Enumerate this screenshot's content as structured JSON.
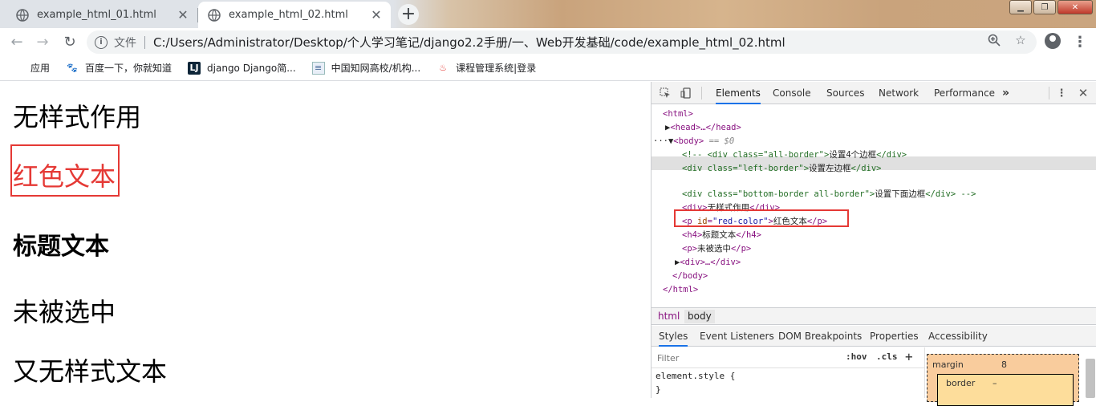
{
  "tabs": [
    {
      "title": "example_html_01.html"
    },
    {
      "title": "example_html_02.html"
    }
  ],
  "omnibox": {
    "file_label": "文件",
    "url": "C:/Users/Administrator/Desktop/个人学习笔记/django2.2手册/一、Web开发基础/code/example_html_02.html"
  },
  "bookmarks": [
    {
      "label": "应用",
      "icon": "apps-grid-icon"
    },
    {
      "label": "百度一下，你就知道",
      "icon": "baidu-paw-icon"
    },
    {
      "label": "django Django简...",
      "icon": "lj-logo-icon"
    },
    {
      "label": "中国知网高校/机构...",
      "icon": "document-icon"
    },
    {
      "label": "课程管理系统|登录",
      "icon": "flame-icon"
    }
  ],
  "page": {
    "line1": "无样式作用",
    "line2": "红色文本",
    "line3": "标题文本",
    "line4": "未被选中",
    "line5": "又无样式文本",
    "accent_red": "#e53935"
  },
  "devtools": {
    "tabs": [
      "Elements",
      "Console",
      "Sources",
      "Network",
      "Performance"
    ],
    "more": "»",
    "dom": {
      "html_open": "<html>",
      "head": "<head>…</head>",
      "body_tag": "<body>",
      "body_suffix": "== $0",
      "comment1_prefix": "<!-- <div class=\"all-border\">",
      "comment1_text": "设置4个边框",
      "comment1_close": "</div>",
      "comment2_open": "<div class=\"left-border\">",
      "comment2_text": "设置左边框",
      "comment2_close": "</div>",
      "comment3_open": "<div class=\"bottom-border all-border\">",
      "comment3_text": "设置下面边框",
      "comment3_close": "</div> -->",
      "div1_open": "<div>",
      "div1_text": "无样式作用",
      "div1_close": "</div>",
      "p_open_tag": "<p ",
      "p_attr": "id",
      "p_val": "\"red-color\"",
      "p_text": "红色文本",
      "p_close": "</p>",
      "h4_open": "<h4>",
      "h4_text": "标题文本",
      "h4_close": "</h4>",
      "p2_open": "<p>",
      "p2_text": "未被选中",
      "p2_close": "</p>",
      "div2": "<div>…</div>",
      "body_close": "</body>",
      "html_close": "</html>"
    },
    "breadcrumbs": [
      "html",
      "body"
    ],
    "subtabs": [
      "Styles",
      "Event Listeners",
      "DOM Breakpoints",
      "Properties",
      "Accessibility"
    ],
    "filter_placeholder": "Filter",
    "hov": ":hov",
    "cls": ".cls",
    "rule_line1": "element.style {",
    "rule_line2": "}",
    "box": {
      "margin_label": "margin",
      "margin_value": "8",
      "border_label": "border",
      "border_value": "–"
    }
  }
}
